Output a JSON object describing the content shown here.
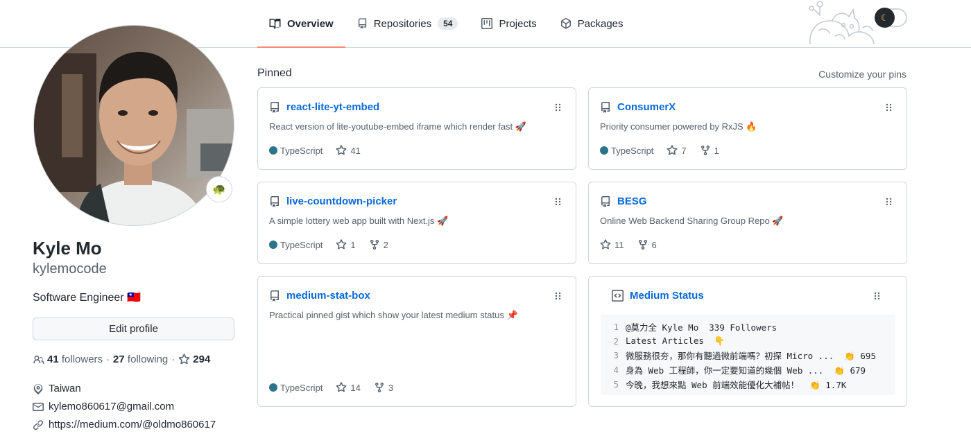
{
  "nav": {
    "tabs": [
      {
        "label": "Overview",
        "icon": "book-icon",
        "active": true
      },
      {
        "label": "Repositories",
        "icon": "repo-icon",
        "count": "54"
      },
      {
        "label": "Projects",
        "icon": "project-icon"
      },
      {
        "label": "Packages",
        "icon": "package-icon"
      }
    ],
    "theme_toggle_icon": "moon-icon"
  },
  "profile": {
    "name": "Kyle Mo",
    "login": "kylemocode",
    "bio": "Software Engineer 🇹🇼",
    "status_emoji": "🐢",
    "edit_button": "Edit profile",
    "followers_count": "41",
    "followers_label": "followers",
    "following_count": "27",
    "following_label": "following",
    "stars_count": "294",
    "location": "Taiwan",
    "email": "kylemo860617@gmail.com",
    "website": "https://medium.com/@oldmo860617"
  },
  "pinned": {
    "title": "Pinned",
    "customize_label": "Customize your pins",
    "items": [
      {
        "name": "react-lite-yt-embed",
        "description": "React version of lite-youtube-embed iframe which render fast 🚀",
        "language": "TypeScript",
        "stars": "41"
      },
      {
        "name": "ConsumerX",
        "description": "Priority consumer powered by RxJS 🔥",
        "language": "TypeScript",
        "stars": "7",
        "forks": "1"
      },
      {
        "name": "live-countdown-picker",
        "description": "A simple lottery web app built with Next.js 🚀",
        "language": "TypeScript",
        "stars": "1",
        "forks": "2"
      },
      {
        "name": "BESG",
        "description": "Online Web Backend Sharing Group Repo 🚀",
        "stars": "11",
        "forks": "6"
      },
      {
        "name": "medium-stat-box",
        "description": "Practical pinned gist which show your latest medium status 📌",
        "language": "TypeScript",
        "stars": "14",
        "forks": "3"
      }
    ],
    "gist": {
      "name": "Medium Status",
      "lines": [
        {
          "n": "1",
          "text": "@莫力全 Kyle Mo  339 Followers"
        },
        {
          "n": "2",
          "text": "Latest Articles  👇"
        },
        {
          "n": "3",
          "text": "微服務很夯，那你有聽過微前端嗎？初探 Micro ...  👏 695"
        },
        {
          "n": "4",
          "text": "身為 Web 工程師，你一定要知道的幾個 Web ...  👏 679"
        },
        {
          "n": "5",
          "text": "今晚，我想來點 Web 前端效能優化大補帖！  👏 1.7K"
        }
      ]
    }
  },
  "colors": {
    "link": "#0969da",
    "typescript": "#2b7489",
    "active_tab_underline": "#fd8c73"
  }
}
